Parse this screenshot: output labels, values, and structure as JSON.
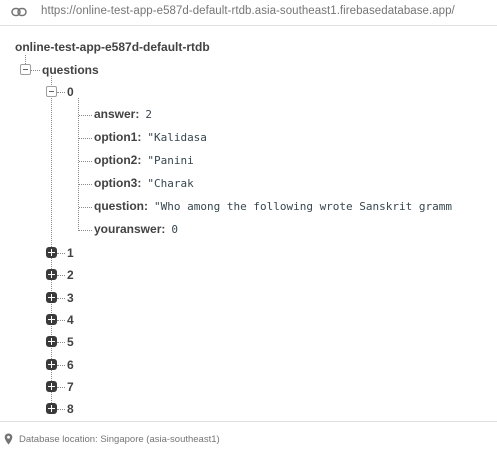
{
  "url_bar": {
    "icon": "link-icon",
    "url": "https://online-test-app-e587d-default-rtdb.asia-southeast1.firebasedatabase.app/"
  },
  "tree": {
    "root": "online-test-app-e587d-default-rtdb",
    "questions_key": "questions",
    "expanded_item": {
      "key": "0",
      "fields": [
        {
          "key": "answer",
          "value": "2"
        },
        {
          "key": "option1",
          "value": "\"Kalidasa"
        },
        {
          "key": "option2",
          "value": "\"Panini"
        },
        {
          "key": "option3",
          "value": "\"Charak"
        },
        {
          "key": "question",
          "value": "\"Who among the following wrote Sanskrit gramm"
        },
        {
          "key": "youranswer",
          "value": "0"
        }
      ]
    },
    "collapsed_items": [
      "1",
      "2",
      "3",
      "4",
      "5",
      "6",
      "7",
      "8"
    ]
  },
  "footer": {
    "icon": "location-pin-icon",
    "text": "Database location: Singapore (asia-southeast1)"
  },
  "colors": {
    "border": "#e0e0e0",
    "muted_text": "#757575",
    "key_text": "#424242",
    "expand_button": "#3a3a3a"
  }
}
